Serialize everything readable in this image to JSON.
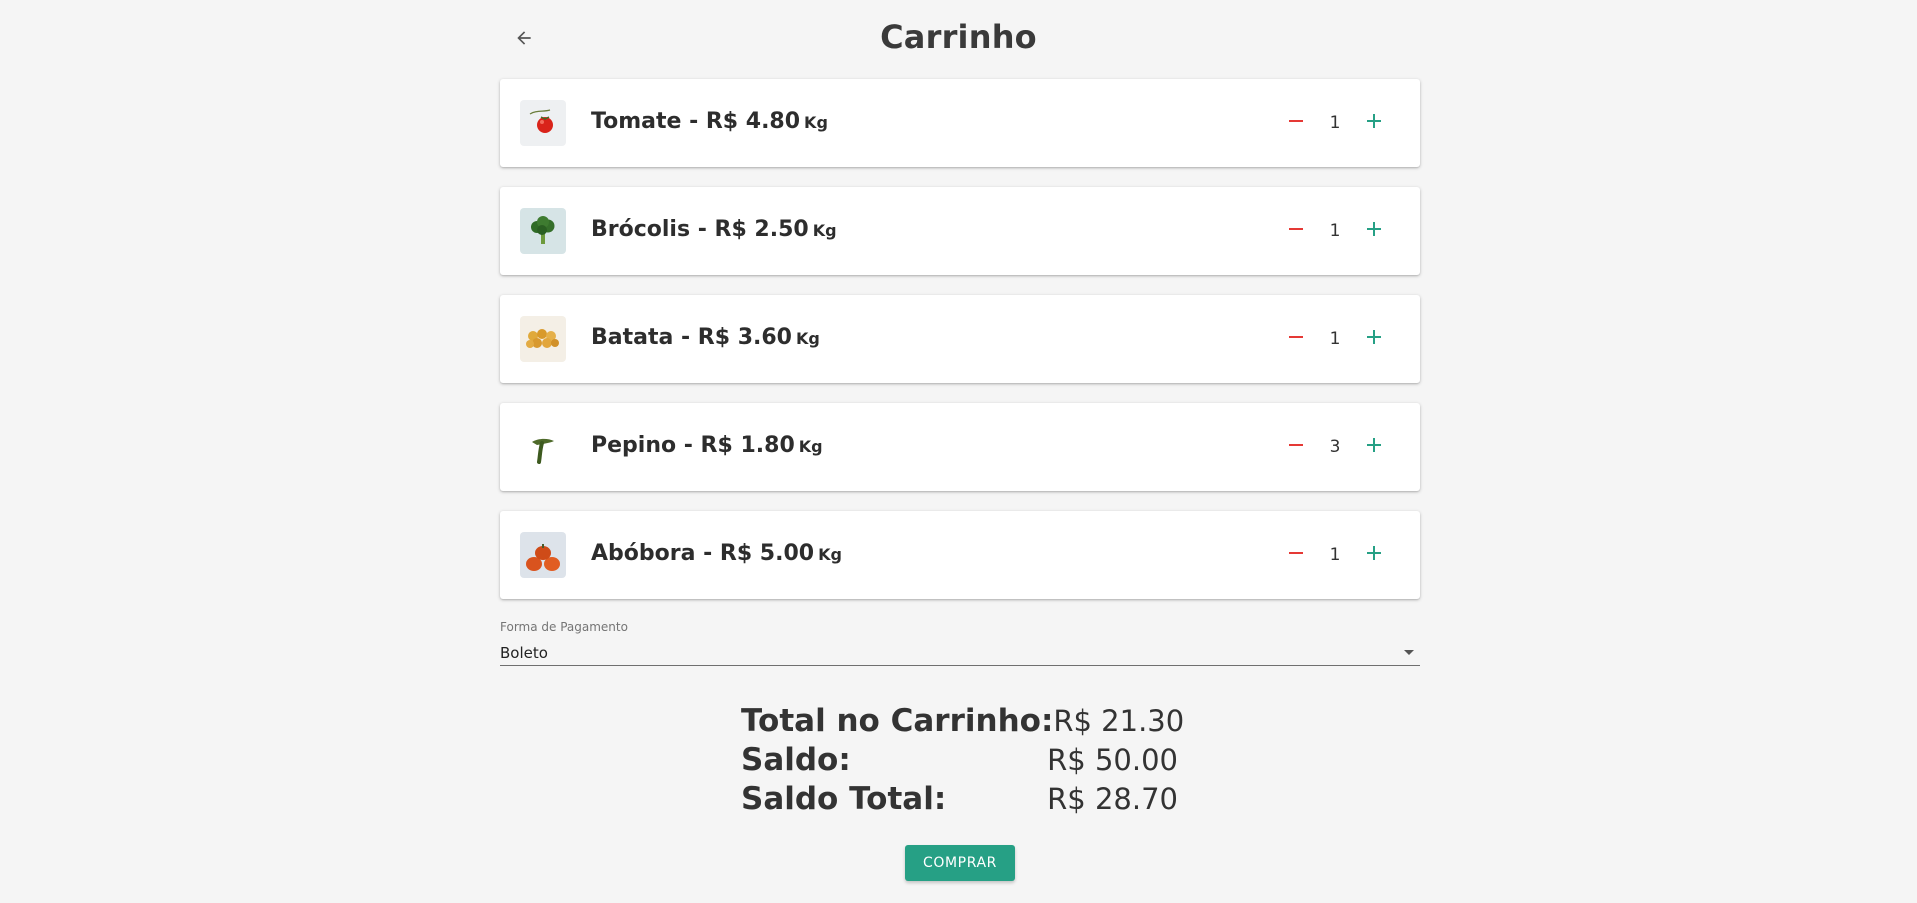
{
  "header": {
    "title": "Carrinho",
    "back_icon": "arrow-left-icon"
  },
  "colors": {
    "accent": "#26a085",
    "remove": "#e53935",
    "add": "#26a085",
    "background": "#f5f5f5"
  },
  "cart": {
    "items": [
      {
        "name": "Tomate",
        "label": "Tomate - R$ 4.80",
        "unit": "Kg",
        "quantity": "1",
        "image_icon": "tomato-image"
      },
      {
        "name": "Brócolis",
        "label": "Brócolis - R$ 2.50",
        "unit": "Kg",
        "quantity": "1",
        "image_icon": "broccoli-image"
      },
      {
        "name": "Batata",
        "label": "Batata - R$ 3.60",
        "unit": "Kg",
        "quantity": "1",
        "image_icon": "potato-image"
      },
      {
        "name": "Pepino",
        "label": "Pepino - R$ 1.80",
        "unit": "Kg",
        "quantity": "3",
        "image_icon": "cucumber-image"
      },
      {
        "name": "Abóbora",
        "label": "Abóbora - R$ 5.00",
        "unit": "Kg",
        "quantity": "1",
        "image_icon": "pumpkin-image"
      }
    ]
  },
  "payment": {
    "label": "Forma de Pagamento",
    "selected": "Boleto"
  },
  "totals": {
    "cart_total_label": "Total no Carrinho:",
    "cart_total_value": "R$ 21.30",
    "balance_label": "Saldo:",
    "balance_value": "R$ 50.00",
    "final_balance_label": "Saldo Total:",
    "final_balance_value": "R$ 28.70"
  },
  "actions": {
    "buy_label": "COMPRAR"
  }
}
